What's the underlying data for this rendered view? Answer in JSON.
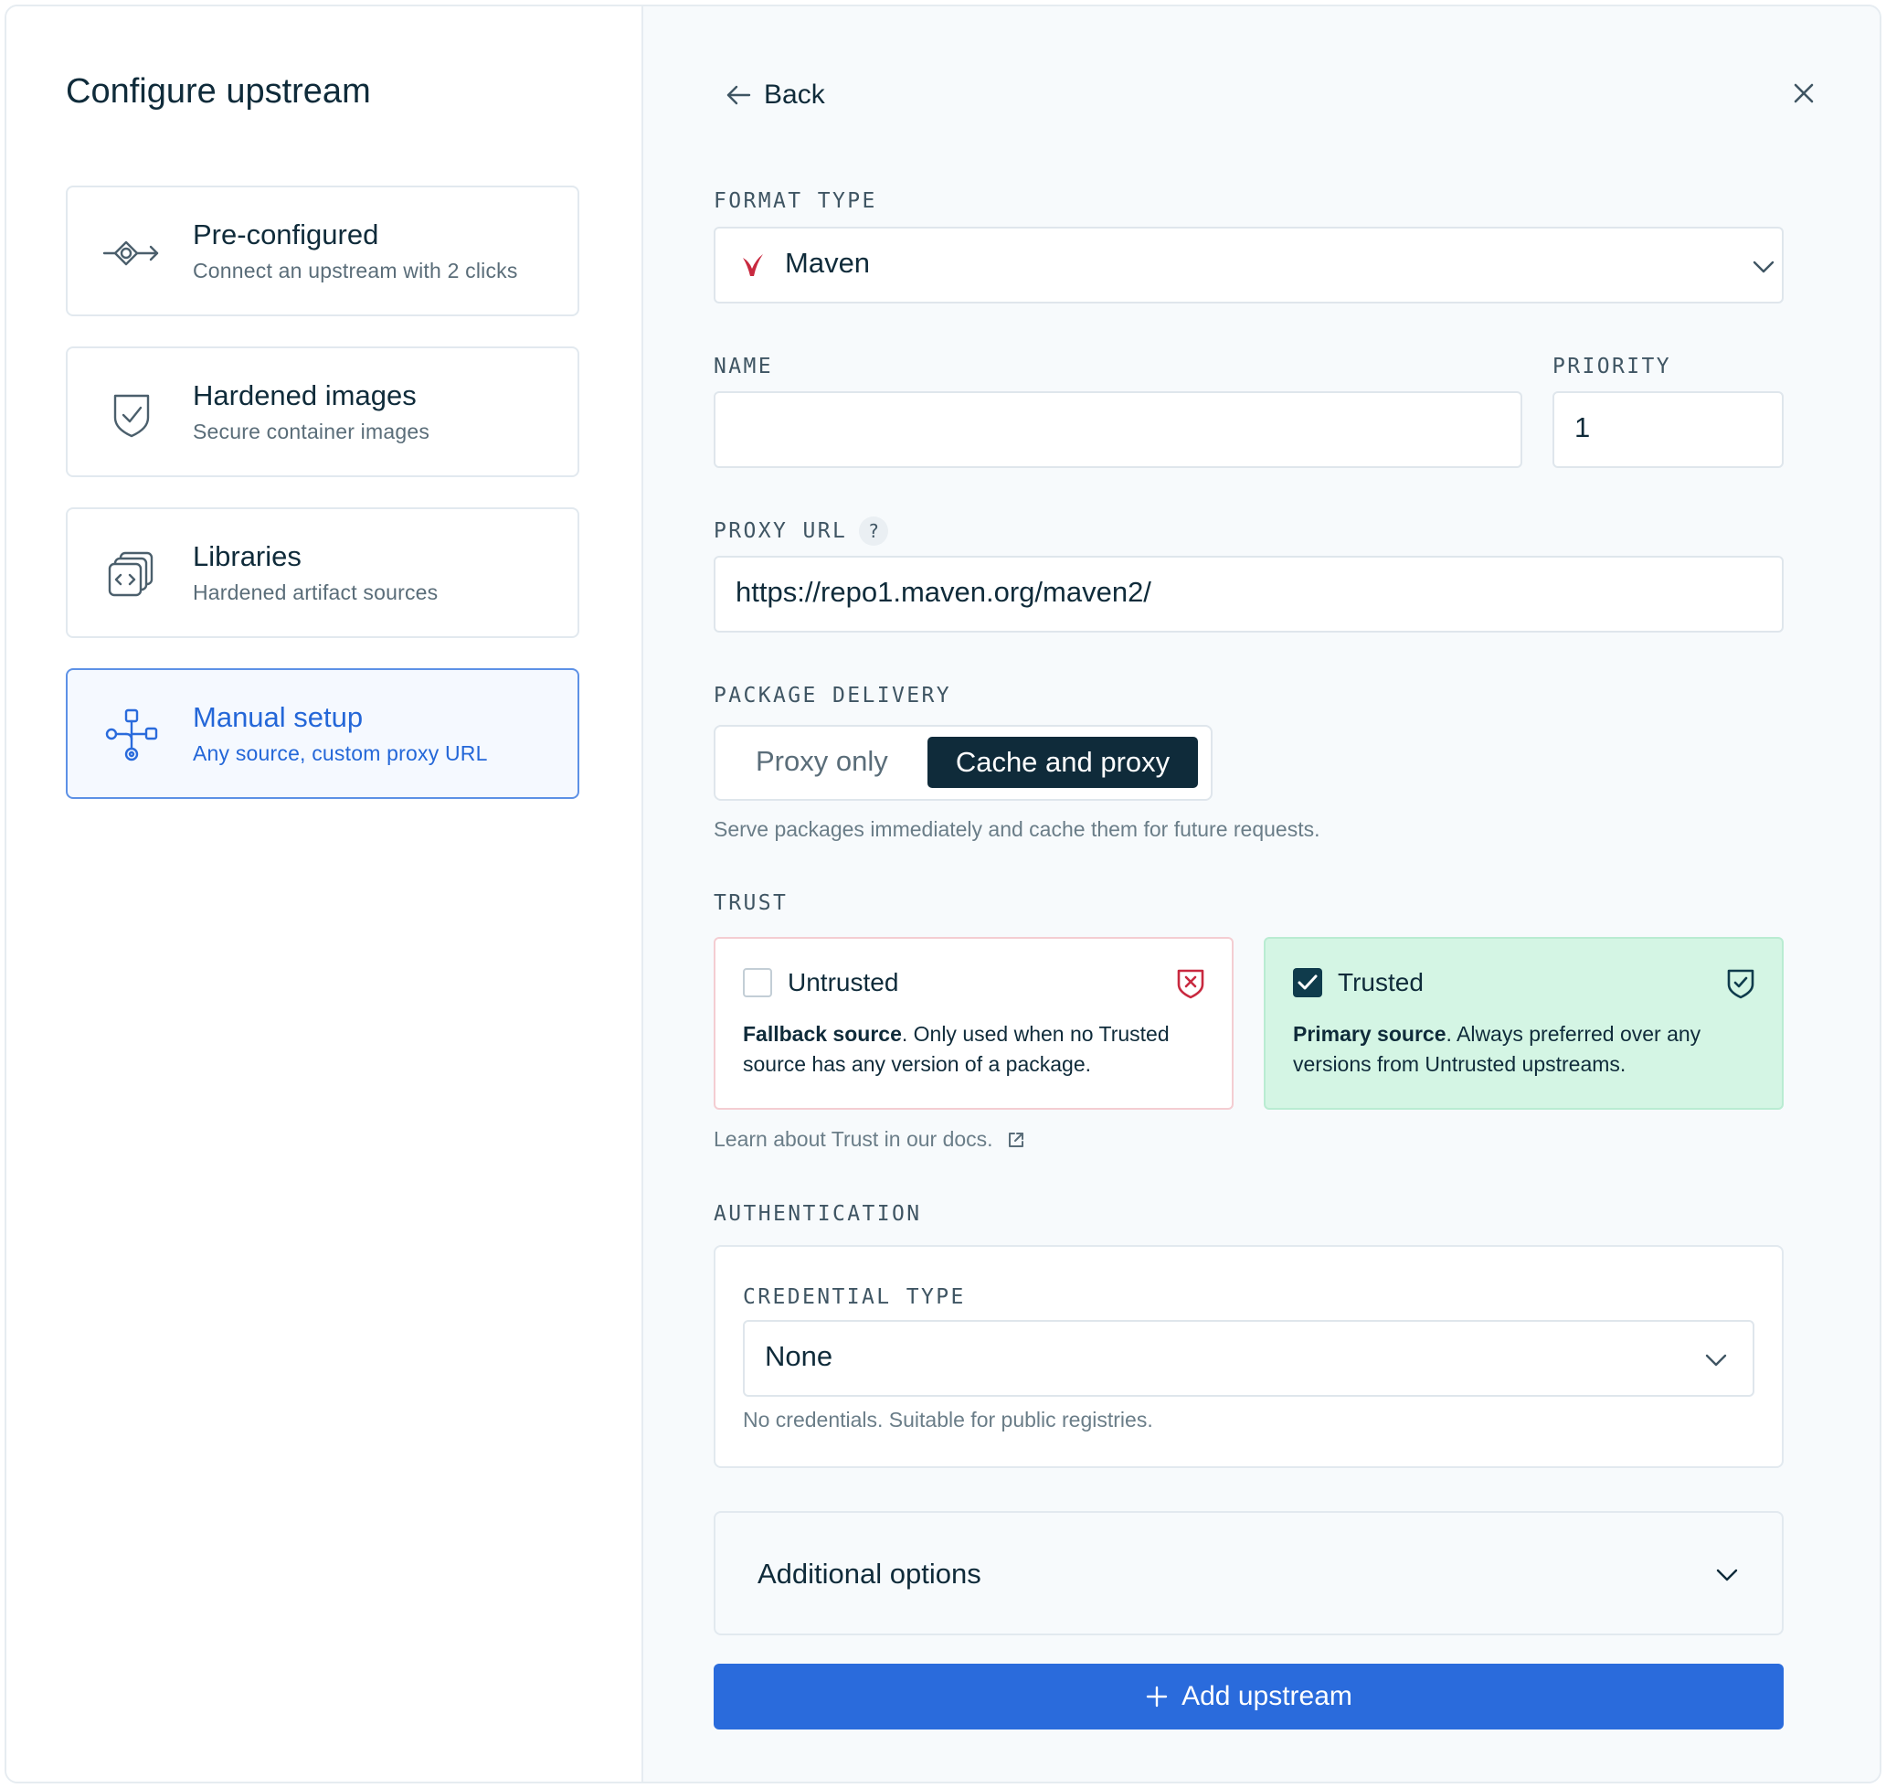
{
  "left": {
    "title": "Configure upstream",
    "options": [
      {
        "title": "Pre-configured",
        "subtitle": "Connect an upstream with 2 clicks",
        "icon": "connect-icon"
      },
      {
        "title": "Hardened images",
        "subtitle": "Secure container images",
        "icon": "shield-check-icon"
      },
      {
        "title": "Libraries",
        "subtitle": "Hardened artifact sources",
        "icon": "stacked-code-icon"
      },
      {
        "title": "Manual setup",
        "subtitle": "Any source, custom proxy URL",
        "icon": "network-icon",
        "selected": true
      }
    ]
  },
  "header": {
    "back_label": "Back"
  },
  "form": {
    "format_type": {
      "label": "FORMAT TYPE",
      "value": "Maven"
    },
    "name": {
      "label": "NAME",
      "value": ""
    },
    "priority": {
      "label": "PRIORITY",
      "value": "1"
    },
    "proxy_url": {
      "label": "PROXY URL",
      "help": "?",
      "value": "https://repo1.maven.org/maven2/"
    },
    "package_delivery": {
      "label": "PACKAGE DELIVERY",
      "options": [
        "Proxy only",
        "Cache and proxy"
      ],
      "selected": "Cache and proxy",
      "hint": "Serve packages immediately and cache them for future requests."
    },
    "trust": {
      "label": "TRUST",
      "untrusted": {
        "title": "Untrusted",
        "bold": "Fallback source",
        "text": ". Only used when no Trusted source has any version of a package.",
        "checked": false
      },
      "trusted": {
        "title": "Trusted",
        "bold": "Primary source",
        "text": ". Always preferred over any versions from Untrusted upstreams.",
        "checked": true
      },
      "docs_link": "Learn about Trust in our docs."
    },
    "authentication": {
      "label": "AUTHENTICATION",
      "credential_label": "CREDENTIAL TYPE",
      "credential_value": "None",
      "hint": "No credentials. Suitable for public registries."
    },
    "additional_options": "Additional options",
    "submit_label": "Add upstream"
  },
  "colors": {
    "accent": "#2a6bdc",
    "dark": "#0f2b3a",
    "trusted_bg": "#d4f5e4",
    "untrusted_border": "#f4cdd2",
    "maven_red": "#c8293f"
  }
}
